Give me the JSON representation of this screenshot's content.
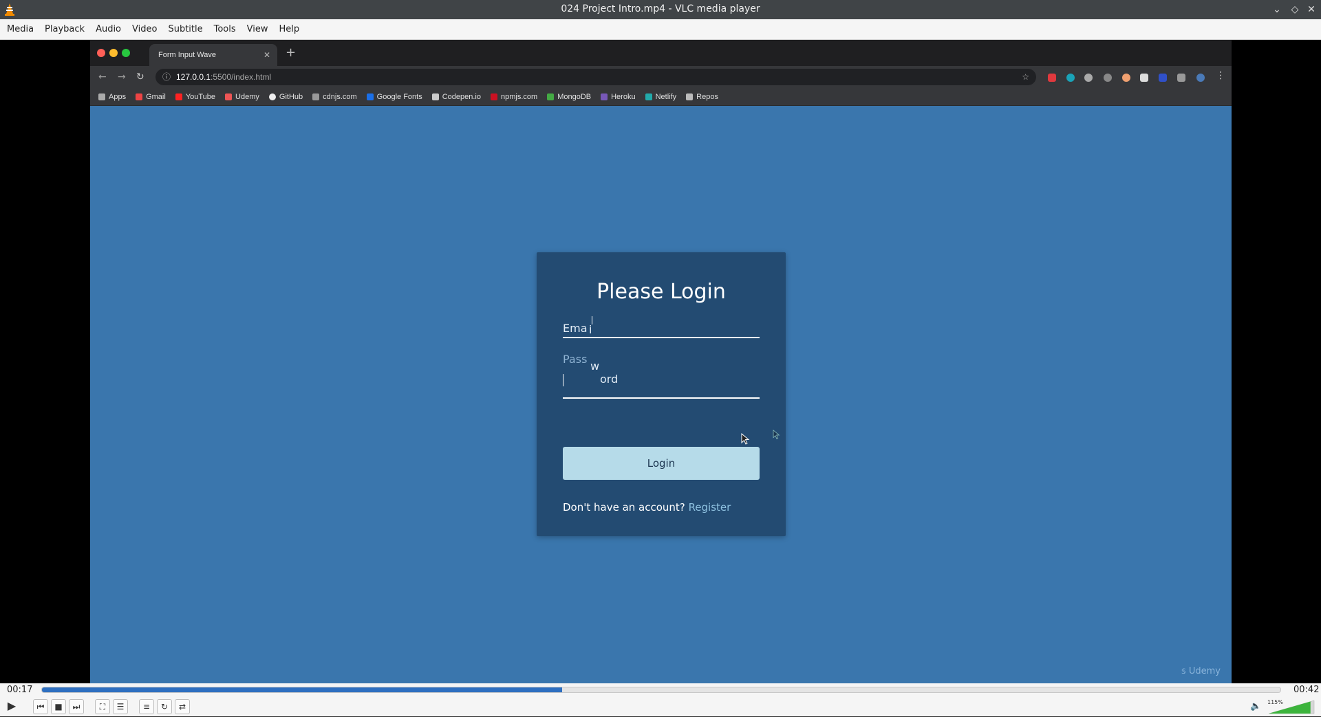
{
  "window": {
    "title": "024 Project Intro.mp4 - VLC media player"
  },
  "menu": [
    "Media",
    "Playback",
    "Audio",
    "Video",
    "Subtitle",
    "Tools",
    "View",
    "Help"
  ],
  "browser": {
    "tab_title": "Form Input Wave",
    "url_host": "127.0.0.1",
    "url_rest": ":5500/index.html",
    "bookmarks": [
      "Apps",
      "Gmail",
      "YouTube",
      "Udemy",
      "GitHub",
      "cdnjs.com",
      "Google Fonts",
      "Codepen.io",
      "npmjs.com",
      "MongoDB",
      "Heroku",
      "Netlify",
      "Repos"
    ]
  },
  "login": {
    "title": "Please Login",
    "email_label_a": "Ema",
    "email_label_b": "i",
    "password_label_a": "Pass",
    "password_label_b": "w",
    "password_label_c": "ord",
    "button": "Login",
    "register_prompt": "Don't have an account?",
    "register_link": "Register"
  },
  "watermark": "Udemy",
  "player": {
    "elapsed": "00:17",
    "total": "00:42",
    "progress_fraction": 0.42,
    "volume": "115%",
    "volume_fraction": 0.92
  },
  "colors": {
    "accent": "#2e6fc0",
    "page_bg": "#3a76ad",
    "card_bg": "#234b72",
    "button_bg": "#b6dbe9"
  }
}
